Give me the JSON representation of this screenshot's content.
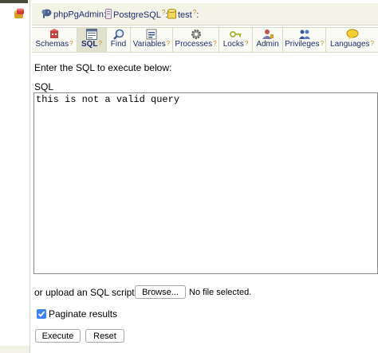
{
  "breadcrumb": {
    "server": "phpPgAdmin",
    "db_engine": "PostgreSQL",
    "database": "test",
    "separator": ":",
    "help_mark": "?"
  },
  "tabs": [
    {
      "label": "Schemas",
      "icon": "schemas-icon",
      "help": true
    },
    {
      "label": "SQL",
      "icon": "sql-icon",
      "help": true,
      "active": true
    },
    {
      "label": "Find",
      "icon": "find-icon",
      "help": false
    },
    {
      "label": "Variables",
      "icon": "variables-icon",
      "help": true
    },
    {
      "label": "Processes",
      "icon": "processes-icon",
      "help": true
    },
    {
      "label": "Locks",
      "icon": "locks-icon",
      "help": true
    },
    {
      "label": "Admin",
      "icon": "admin-icon",
      "help": false
    },
    {
      "label": "Privileges",
      "icon": "privileges-icon",
      "help": true
    },
    {
      "label": "Languages",
      "icon": "languages-icon",
      "help": true
    }
  ],
  "main": {
    "instructions": "Enter the SQL to execute below:",
    "sql_label": "SQL",
    "sql_value": "this is not a valid query",
    "upload_label": "or upload an SQL script:",
    "browse_label": "Browse...",
    "no_file": "No file selected.",
    "paginate_label": "Paginate results",
    "paginate_checked": true,
    "execute_label": "Execute",
    "reset_label": "Reset"
  },
  "colors": {
    "link": "#1e2c6e",
    "help": "#c08a10",
    "tab_active": "#e1e1d0",
    "checkbox": "#3b82f6"
  }
}
